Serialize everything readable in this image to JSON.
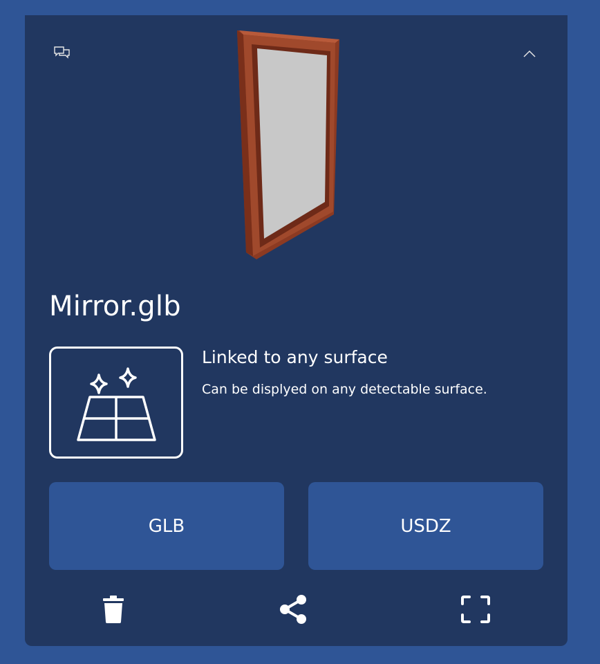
{
  "model": {
    "file_name": "Mirror.glb"
  },
  "placement": {
    "heading": "Linked to any surface",
    "description": "Can be displyed on any detectable surface."
  },
  "formats": {
    "glb_label": "GLB",
    "usdz_label": "USDZ"
  },
  "icons": {
    "top_left": "chat-bubbles-icon",
    "top_right": "chevron-up-icon",
    "placement": "sparkle-floor-icon",
    "delete": "trash-icon",
    "share": "share-icon",
    "fullscreen": "fullscreen-icon"
  },
  "colors": {
    "page_background": "#2f5596",
    "card_background": "#213760",
    "button_background": "#2f5596",
    "frame_wood": "#a0492c",
    "mirror_glass": "#c8c8c8"
  }
}
